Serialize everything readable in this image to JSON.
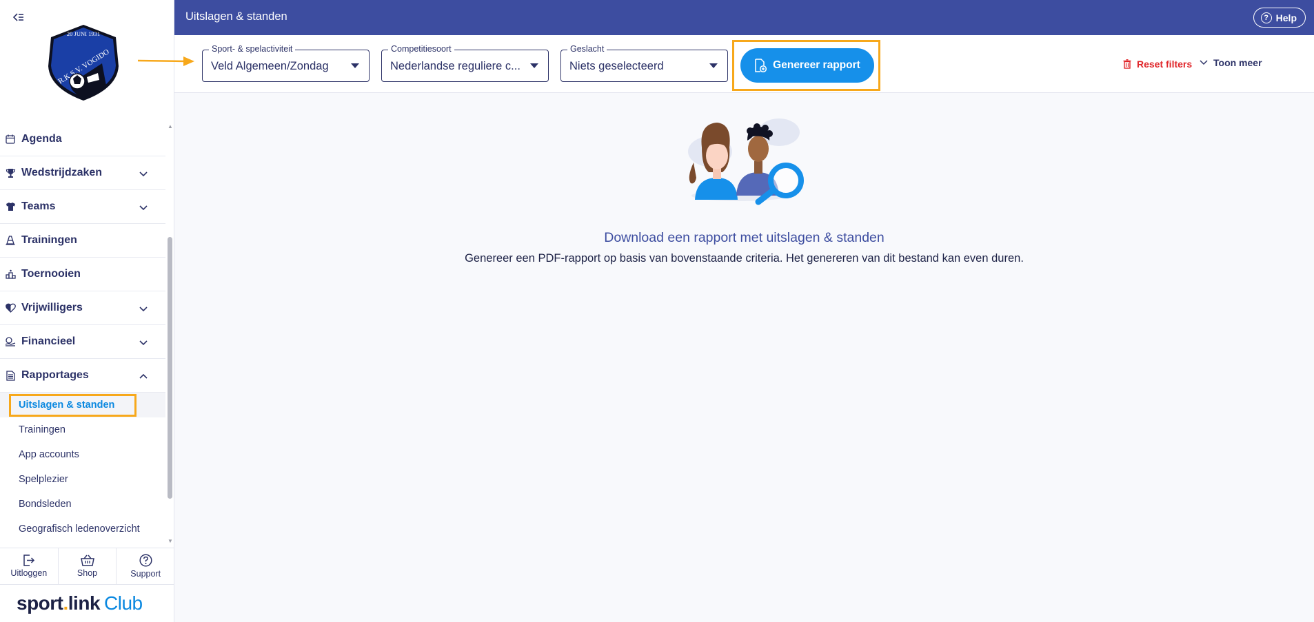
{
  "sidebar": {
    "logo": {
      "top_text": "20 JUNI 1931",
      "club_name": "R.K.S.V. VOGIDO"
    },
    "nav": [
      {
        "label": "Agenda",
        "icon": "calendar-icon",
        "expandable": false
      },
      {
        "label": "Wedstrijdzaken",
        "icon": "trophy-icon",
        "expandable": true
      },
      {
        "label": "Teams",
        "icon": "shirt-icon",
        "expandable": true
      },
      {
        "label": "Trainingen",
        "icon": "cone-icon",
        "expandable": false
      },
      {
        "label": "Toernooien",
        "icon": "podium-icon",
        "expandable": false
      },
      {
        "label": "Vrijwilligers",
        "icon": "heart-icon",
        "expandable": true
      },
      {
        "label": "Financieel",
        "icon": "money-icon",
        "expandable": true
      },
      {
        "label": "Rapportages",
        "icon": "report-icon",
        "expandable": true,
        "expanded": true
      }
    ],
    "sub_items": [
      {
        "label": "Uitslagen & standen",
        "active": true
      },
      {
        "label": "Trainingen"
      },
      {
        "label": "App accounts"
      },
      {
        "label": "Spelplezier"
      },
      {
        "label": "Bondsleden"
      },
      {
        "label": "Geografisch ledenoverzicht"
      }
    ],
    "bottom": [
      {
        "label": "Uitloggen",
        "icon": "logout-icon"
      },
      {
        "label": "Shop",
        "icon": "basket-icon"
      },
      {
        "label": "Support",
        "icon": "question-icon"
      }
    ],
    "brand": {
      "part1": "sport",
      "dot": ".",
      "part2": "link",
      "part3": "Club"
    }
  },
  "header": {
    "title": "Uitslagen & standen",
    "help_label": "Help"
  },
  "filters": {
    "sport": {
      "label": "Sport- & spelactiviteit",
      "value": "Veld Algemeen/Zondag"
    },
    "competitie": {
      "label": "Competitiesoort",
      "value": "Nederlandse reguliere c..."
    },
    "geslacht": {
      "label": "Geslacht",
      "value": "Niets geselecteerd"
    },
    "generate_label": "Genereer rapport",
    "reset_label": "Reset filters",
    "more_label": "Toon meer"
  },
  "main": {
    "title": "Download een rapport met uitslagen & standen",
    "description": "Genereer een PDF-rapport op basis van bovenstaande criteria. Het genereren van dit bestand kan even duren."
  },
  "colors": {
    "header_bg": "#3d4da0",
    "accent_blue": "#1690ea",
    "highlight_orange": "#f7a81b",
    "danger_red": "#e0262a",
    "text_navy": "#2c3267"
  }
}
